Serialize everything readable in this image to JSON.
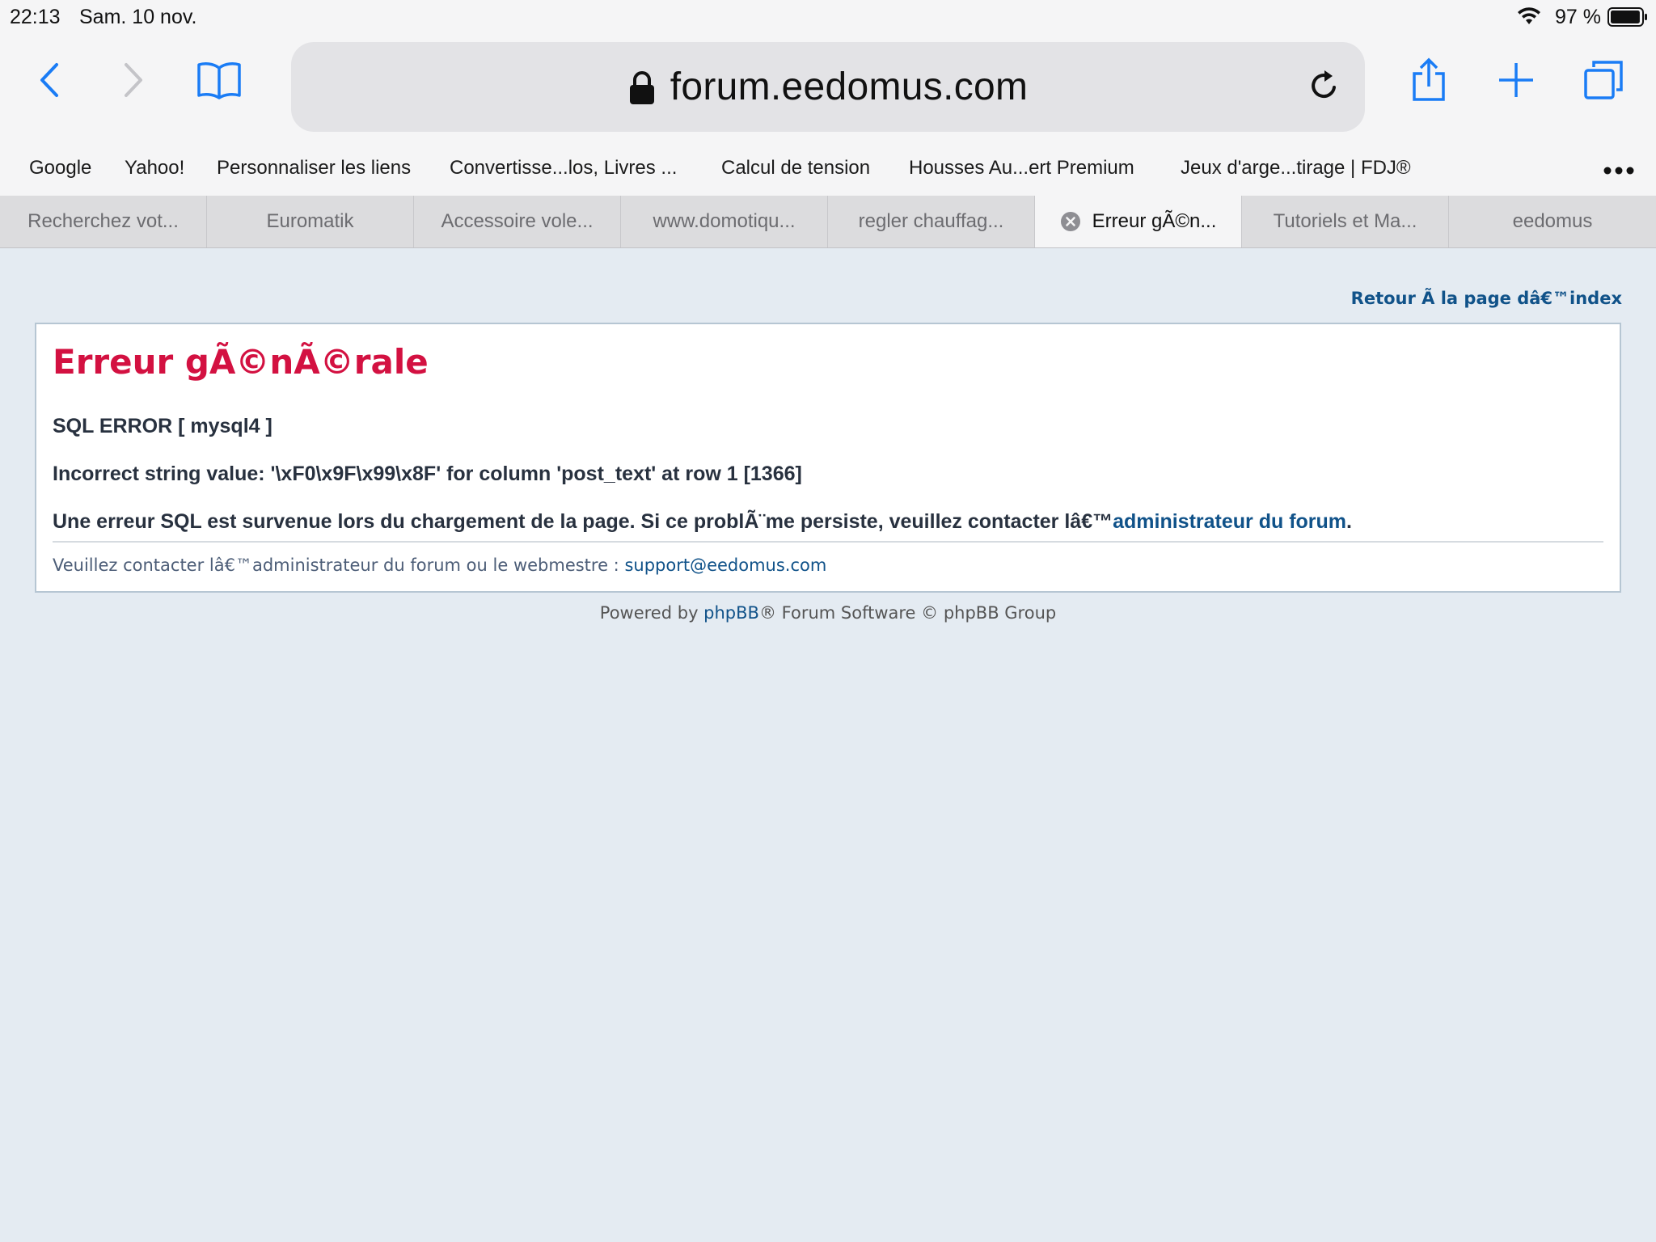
{
  "status_bar": {
    "time": "22:13",
    "date": "Sam. 10 nov.",
    "battery_text": "97 %",
    "battery_level": 0.97,
    "wifi_icon": "wifi-icon"
  },
  "toolbar": {
    "url": "forum.eedomus.com",
    "accent_color": "#1a7cf5"
  },
  "bookmarks": [
    "Google",
    "Yahoo!",
    "Personnaliser les liens",
    "Convertisse...los, Livres ...",
    "Calcul de tension",
    "Housses Au...ert Premium",
    "Jeux d'arge...tirage | FDJ®"
  ],
  "tabs": [
    "Recherchez vot...",
    "Euromatik",
    "Accessoire vole...",
    "www.domotiqu...",
    "regler chauffag...",
    "Erreur gÃ©n...",
    "Tutoriels et Ma...",
    "eedomus"
  ],
  "page": {
    "return_link": "Retour Ã  la page dâ€™index",
    "title": "Erreur gÃ©nÃ©rale",
    "sql_error": "SQL ERROR [ mysql4 ]",
    "incorrect_value": "Incorrect string value: '\\xF0\\x9F\\x99\\x8F' for column 'post_text' at row 1 [1366]",
    "sql_message_prefix": "Une erreur SQL est survenue lors du chargement de la page. Si ce problÃ¨me persiste, veuillez contacter lâ€™",
    "admin_link": "administrateur du forum",
    "sql_message_suffix": ".",
    "contact_prefix": "Veuillez contacter lâ€™administrateur du forum ou le webmestre : ",
    "contact_email": "support@eedomus.com",
    "footer_prefix": "Powered by ",
    "footer_link": "phpBB",
    "footer_suffix": "® Forum Software © phpBB Group",
    "title_color": "#d31141",
    "link_color": "#105289"
  }
}
